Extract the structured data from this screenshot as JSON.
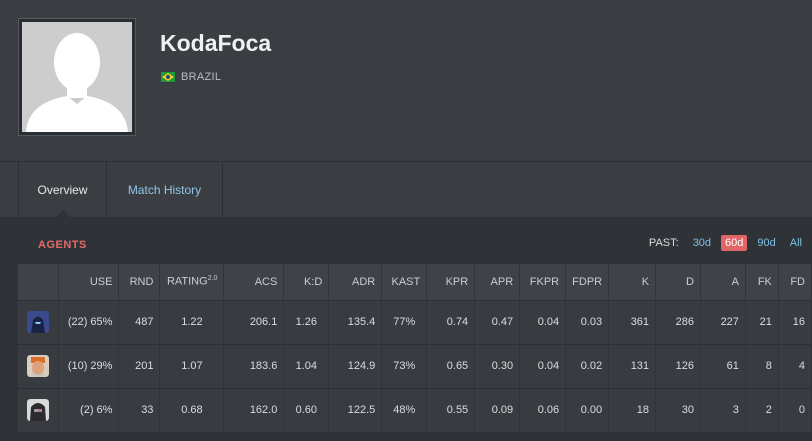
{
  "player": {
    "name": "KodaFoca",
    "country": "BRAZIL",
    "flag_icon": "brazil-flag-icon"
  },
  "tabs": [
    {
      "label": "Overview",
      "active": true
    },
    {
      "label": "Match History",
      "active": false
    }
  ],
  "agents_section": {
    "title": "AGENTS",
    "past_label": "PAST:",
    "ranges": [
      {
        "label": "30d",
        "active": false
      },
      {
        "label": "60d",
        "active": true
      },
      {
        "label": "90d",
        "active": false
      },
      {
        "label": "All",
        "active": false
      }
    ]
  },
  "table": {
    "columns": [
      "",
      "USE",
      "RND",
      "RATING",
      "ACS",
      "K:D",
      "ADR",
      "KAST",
      "KPR",
      "APR",
      "FKPR",
      "FDPR",
      "K",
      "D",
      "A",
      "FK",
      "FD"
    ],
    "rating_sup": "2.0",
    "rows": [
      {
        "agent_icon": "agent-omen-icon",
        "cells": [
          "(22) 65%",
          "487",
          "1.22",
          "206.1",
          "1.26",
          "135.4",
          "77%",
          "0.74",
          "0.47",
          "0.04",
          "0.03",
          "361",
          "286",
          "227",
          "21",
          "16"
        ]
      },
      {
        "agent_icon": "agent-brimstone-icon",
        "cells": [
          "(10) 29%",
          "201",
          "1.07",
          "183.6",
          "1.04",
          "124.9",
          "73%",
          "0.65",
          "0.30",
          "0.04",
          "0.02",
          "131",
          "126",
          "61",
          "8",
          "4"
        ]
      },
      {
        "agent_icon": "agent-cypher-icon",
        "cells": [
          "(2) 6%",
          "33",
          "0.68",
          "162.0",
          "0.60",
          "122.5",
          "48%",
          "0.55",
          "0.09",
          "0.06",
          "0.00",
          "18",
          "30",
          "3",
          "2",
          "0"
        ]
      }
    ]
  },
  "colors": {
    "accent_red": "#e06666",
    "link_blue": "#7fbfe6"
  }
}
